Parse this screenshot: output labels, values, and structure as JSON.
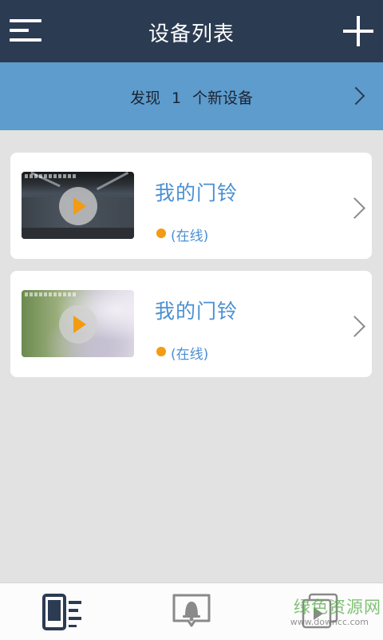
{
  "header": {
    "title": "设备列表",
    "menu_icon": "hamburger-icon",
    "add_icon": "plus-icon"
  },
  "banner": {
    "prefix": "发现",
    "count": "1",
    "suffix": "个新设备",
    "chevron_icon": "chevron-right-icon"
  },
  "devices": [
    {
      "name": "我的门铃",
      "status": "(在线)",
      "status_color": "#f39b12"
    },
    {
      "name": "我的门铃",
      "status": "(在线)",
      "status_color": "#f39b12"
    }
  ],
  "tabbar": {
    "tabs": [
      {
        "icon": "device-list-icon",
        "active": true
      },
      {
        "icon": "bell-message-icon",
        "active": false
      },
      {
        "icon": "video-playback-icon",
        "active": false
      }
    ]
  },
  "watermark": {
    "text": "绿色资源网",
    "url": "www.downcc.com"
  },
  "colors": {
    "header_bg": "#2b3b52",
    "banner_bg": "#5d9ccd",
    "accent_blue": "#4a90d4",
    "status_orange": "#f39b12"
  }
}
